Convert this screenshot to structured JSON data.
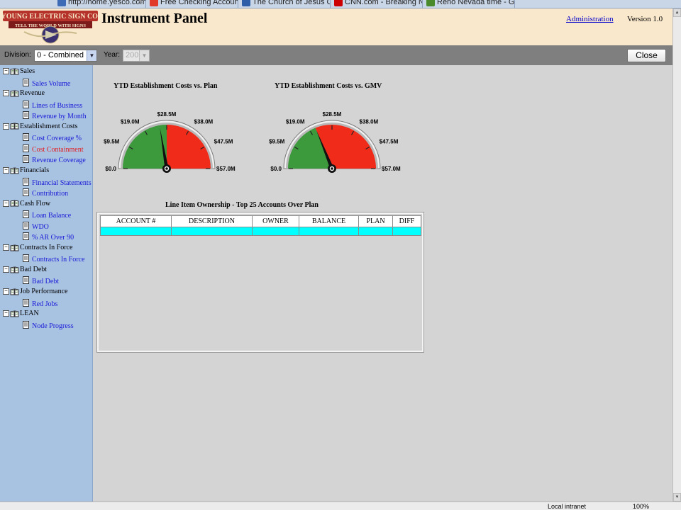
{
  "browser": {
    "tabs": [
      {
        "label": "http://home.yesco.com/...",
        "color": "#3d6bb5"
      },
      {
        "label": "Free Checking Account",
        "color": "#e23a2a"
      },
      {
        "label": "The Church of Jesus Christ ...",
        "color": "#2f5ea8"
      },
      {
        "label": "CNN.com - Breaking News, ...",
        "color": "#cc0000"
      },
      {
        "label": "Reno Nevada time - Google ...",
        "color": "#4a8a2a"
      }
    ]
  },
  "header": {
    "logo_text": "YOUNG ELECTRIC SIGN CO.",
    "logo_tagline": "TELL THE WORLD WITH SIGNS",
    "title": "Instrument Panel",
    "admin_link": "Administration",
    "version": "Version 1.0"
  },
  "toolbar": {
    "division_label": "Division:",
    "division_value": "0 - Combined",
    "year_label": "Year:",
    "year_value": "2009",
    "close_label": "Close"
  },
  "sidebar": {
    "groups": [
      {
        "label": "Sales",
        "items": [
          {
            "label": "Sales Volume",
            "active": false
          }
        ]
      },
      {
        "label": "Revenue",
        "items": [
          {
            "label": "Lines of Business",
            "active": false
          },
          {
            "label": "Revenue by Month",
            "active": false
          }
        ]
      },
      {
        "label": "Establishment Costs",
        "items": [
          {
            "label": "Cost Coverage %",
            "active": false
          },
          {
            "label": "Cost Containment",
            "active": true
          },
          {
            "label": "Revenue Coverage",
            "active": false
          }
        ]
      },
      {
        "label": "Financials",
        "items": [
          {
            "label": "Financial Statements",
            "active": false
          },
          {
            "label": "Contribution",
            "active": false
          }
        ]
      },
      {
        "label": "Cash Flow",
        "items": [
          {
            "label": "Loan Balance",
            "active": false
          },
          {
            "label": "WDO",
            "active": false
          },
          {
            "label": "% AR Over 90",
            "active": false
          }
        ]
      },
      {
        "label": "Contracts In Force",
        "items": [
          {
            "label": "Contracts In Force",
            "active": false
          }
        ]
      },
      {
        "label": "Bad Debt",
        "items": [
          {
            "label": "Bad Debt",
            "active": false
          }
        ]
      },
      {
        "label": "Job Performance",
        "items": [
          {
            "label": "Red Jobs",
            "active": false
          }
        ]
      },
      {
        "label": "LEAN",
        "items": [
          {
            "label": "Node Progress",
            "active": false
          }
        ]
      }
    ]
  },
  "gauges": [
    {
      "title": "YTD Establishment Costs vs. Plan",
      "tick_labels": [
        "$0.0",
        "$9.5M",
        "$19.0M",
        "$28.5M",
        "$38.0M",
        "$47.5M",
        "$57.0M"
      ],
      "min": 0,
      "max": 57.0,
      "green_until": 28.5,
      "needle": 25.5,
      "colors": {
        "good": "#3c9a3c",
        "bad": "#f02b1a"
      }
    },
    {
      "title": "YTD Establishment Costs vs. GMV",
      "tick_labels": [
        "$0.0",
        "$9.5M",
        "$19.0M",
        "$28.5M",
        "$38.0M",
        "$47.5M",
        "$57.0M"
      ],
      "min": 0,
      "max": 57.0,
      "green_until": 21.5,
      "needle": 21.5,
      "colors": {
        "good": "#3c9a3c",
        "bad": "#f02b1a"
      }
    }
  ],
  "table": {
    "title": "Line Item Ownership - Top 25 Accounts Over Plan",
    "columns": [
      "ACCOUNT #",
      "DESCRIPTION",
      "OWNER",
      "BALANCE",
      "PLAN",
      "DIFF"
    ],
    "highlight_color": "#00ffff"
  },
  "status": {
    "zone": "Local intranet",
    "zoom": "100%"
  }
}
